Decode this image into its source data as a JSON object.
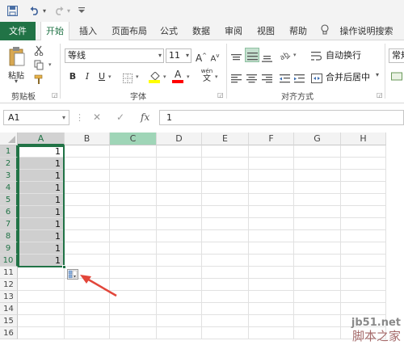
{
  "quick_access": {
    "save_icon": "save-icon",
    "undo_icon": "undo-icon",
    "redo_icon": "redo-icon",
    "customize_icon": "customize-icon"
  },
  "tabs": [
    {
      "label": "文件"
    },
    {
      "label": "开始"
    },
    {
      "label": "插入"
    },
    {
      "label": "页面布局"
    },
    {
      "label": "公式"
    },
    {
      "label": "数据"
    },
    {
      "label": "审阅"
    },
    {
      "label": "视图"
    },
    {
      "label": "帮助"
    }
  ],
  "tell_me": {
    "label": "操作说明搜索",
    "icon": "lightbulb-icon"
  },
  "clipboard": {
    "paste_label": "粘贴",
    "group_label": "剪贴板"
  },
  "font": {
    "name": "等线",
    "size": "11",
    "group_label": "字体",
    "bold": "B",
    "italic": "I",
    "underline": "U",
    "grow": "A",
    "shrink": "A",
    "color_letter": "A",
    "wen": "wén",
    "wen_char": "文",
    "fill_color": "#ffff00",
    "font_color": "#ff0000"
  },
  "alignment": {
    "wrap_label": "自动换行",
    "merge_label": "合并后居中",
    "group_label": "对齐方式"
  },
  "number": {
    "format_label": "常规"
  },
  "formula_bar": {
    "name_box": "A1",
    "cancel": "✕",
    "confirm": "✓",
    "fx": "fx",
    "value": "1"
  },
  "grid": {
    "columns": [
      "A",
      "B",
      "C",
      "D",
      "E",
      "F",
      "G",
      "H"
    ],
    "rows": [
      "1",
      "2",
      "3",
      "4",
      "5",
      "6",
      "7",
      "8",
      "9",
      "10",
      "11",
      "12",
      "13",
      "14",
      "15",
      "16"
    ],
    "values_a": [
      "1",
      "1",
      "1",
      "1",
      "1",
      "1",
      "1",
      "1",
      "1",
      "1"
    ]
  },
  "annotation": {
    "arrow_color": "#e2463a"
  },
  "watermark": {
    "line1": "jb51.net",
    "line2": "脚本之家"
  },
  "colors": {
    "accent": "#217346"
  }
}
